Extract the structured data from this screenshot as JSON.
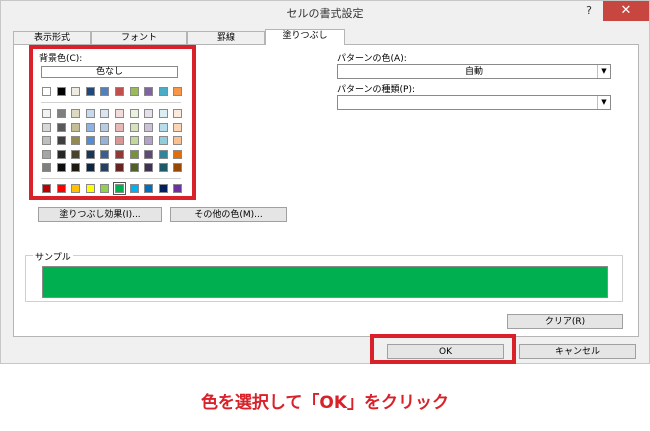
{
  "dialog": {
    "title": "セルの書式設定",
    "help": "?",
    "close": "✕"
  },
  "tabs": [
    "表示形式",
    "フォント",
    "罫線",
    "塗りつぶし"
  ],
  "active_tab": "塗りつぶし",
  "fill": {
    "background_label": "背景色(C):",
    "no_color": "色なし",
    "fill_effects": "塗りつぶし効果(I)...",
    "more_colors": "その他の色(M)...",
    "pattern_color_label": "パターンの色(A):",
    "pattern_color_value": "自動",
    "pattern_style_label": "パターンの種類(P):",
    "pattern_style_value": "",
    "sample_label": "サンプル",
    "sample_color": "#00b050",
    "clear": "クリア(R)"
  },
  "palette": {
    "top_row": [
      "#ffffff",
      "#000000",
      "#eeece1",
      "#1f497d",
      "#4f81bd",
      "#c0504d",
      "#9bbb59",
      "#8064a2",
      "#4bacc6",
      "#f79646"
    ],
    "theme_rows": [
      [
        "#f2f2f2",
        "#7f7f7f",
        "#ddd9c3",
        "#c6d9f0",
        "#dbe5f1",
        "#f2dcdb",
        "#ebf1dd",
        "#e5e0ec",
        "#dbeef3",
        "#fdeada"
      ],
      [
        "#d8d8d8",
        "#595959",
        "#c4bd97",
        "#8db3e2",
        "#b8cce4",
        "#e5b9b7",
        "#d7e3bc",
        "#ccc1d9",
        "#b7dde8",
        "#fbd5b5"
      ],
      [
        "#bfbfbf",
        "#3f3f3f",
        "#938953",
        "#548dd4",
        "#95b3d7",
        "#d99694",
        "#c3d69b",
        "#b2a2c7",
        "#92cddc",
        "#fac08f"
      ],
      [
        "#a5a5a5",
        "#262626",
        "#494429",
        "#17365d",
        "#366092",
        "#953734",
        "#76923c",
        "#5f497a",
        "#31859b",
        "#e36c09"
      ],
      [
        "#7f7f7f",
        "#0c0c0c",
        "#1d1b10",
        "#0f243e",
        "#244061",
        "#632423",
        "#4f6128",
        "#3f3151",
        "#205867",
        "#974806"
      ]
    ],
    "standard_row": [
      "#c00000",
      "#ff0000",
      "#ffc000",
      "#ffff00",
      "#92d050",
      "#00b050",
      "#00b0f0",
      "#0070c0",
      "#002060",
      "#7030a0"
    ],
    "selected_standard_index": 5
  },
  "buttons": {
    "ok": "OK",
    "cancel": "キャンセル"
  },
  "highlight_color": "#d9212a",
  "caption": "色を選択して「OK」をクリック"
}
